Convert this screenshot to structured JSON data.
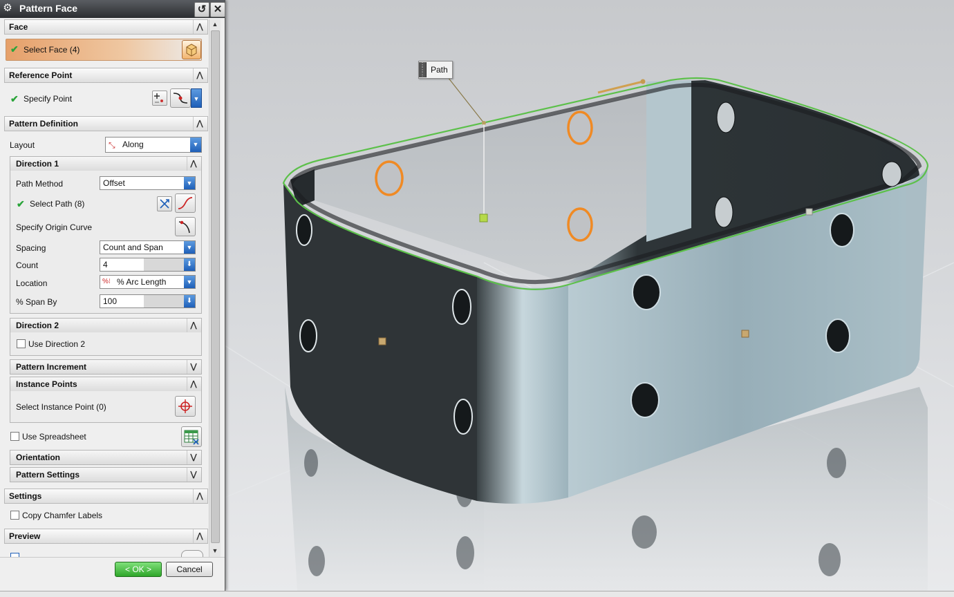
{
  "dialog": {
    "title": "Pattern Face",
    "face": {
      "header": "Face",
      "select_face": "Select Face (4)"
    },
    "reference_point": {
      "header": "Reference Point",
      "specify_point": "Specify Point"
    },
    "pattern_definition": {
      "header": "Pattern Definition",
      "layout_label": "Layout",
      "layout_value": "Along",
      "direction1": {
        "header": "Direction 1",
        "path_method_label": "Path Method",
        "path_method_value": "Offset",
        "select_path": "Select Path (8)",
        "specify_origin_curve": "Specify Origin Curve",
        "spacing_label": "Spacing",
        "spacing_value": "Count and Span",
        "count_label": "Count",
        "count_value": "4",
        "location_label": "Location",
        "location_value": "% Arc Length",
        "span_label": "% Span By",
        "span_value": "100"
      },
      "direction2": {
        "header": "Direction 2",
        "use_direction2": "Use Direction 2"
      },
      "pattern_increment": "Pattern Increment",
      "instance_points": {
        "header": "Instance Points",
        "select_instance_point": "Select Instance Point (0)"
      },
      "use_spreadsheet": "Use Spreadsheet",
      "orientation": "Orientation",
      "pattern_settings": "Pattern Settings"
    },
    "settings": {
      "header": "Settings",
      "copy_chamfer_labels": "Copy Chamfer Labels"
    },
    "preview": {
      "header": "Preview"
    },
    "ok_label": "< OK >",
    "cancel_label": "Cancel"
  },
  "viewport": {
    "path_tag": "Path"
  },
  "colors": {
    "selection_orange": "#f08a24",
    "edge_green": "#5cc04a",
    "box_dark": "#2f3437",
    "box_light": "#8ea4ae"
  }
}
